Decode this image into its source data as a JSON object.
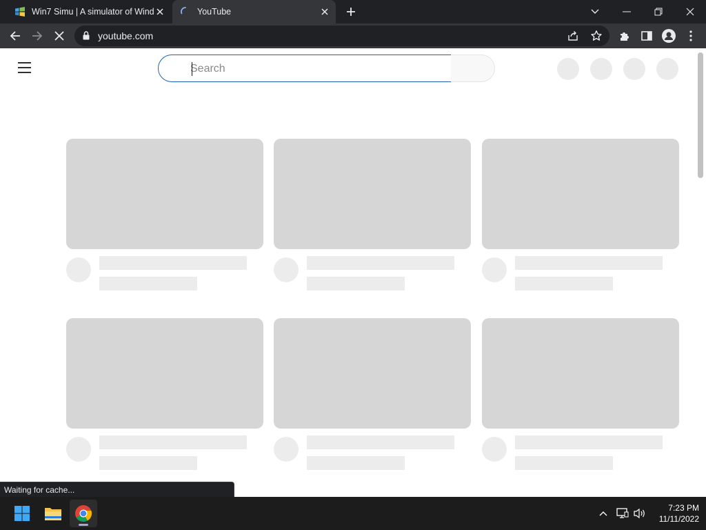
{
  "browser": {
    "tabs": [
      {
        "title": "Win7 Simu | A simulator of Wind",
        "active": false
      },
      {
        "title": "YouTube",
        "active": true
      }
    ],
    "address_bar": {
      "url": "youtube.com"
    }
  },
  "page": {
    "search": {
      "placeholder": "Search",
      "value": ""
    }
  },
  "status_bubble": {
    "text": "Waiting for cache..."
  },
  "taskbar": {
    "apps": [
      "windows-start",
      "file-explorer",
      "chrome"
    ],
    "clock": {
      "time": "7:23 PM",
      "date": "11/11/2022"
    }
  },
  "colors": {
    "tab_strip_bg": "#202124",
    "toolbar_bg": "#35363a",
    "search_border_focus": "#1c62b9",
    "placeholder_thumb": "#d6d6d6",
    "placeholder_text": "#ececec",
    "taskbar_bg": "#1c1c1c"
  }
}
